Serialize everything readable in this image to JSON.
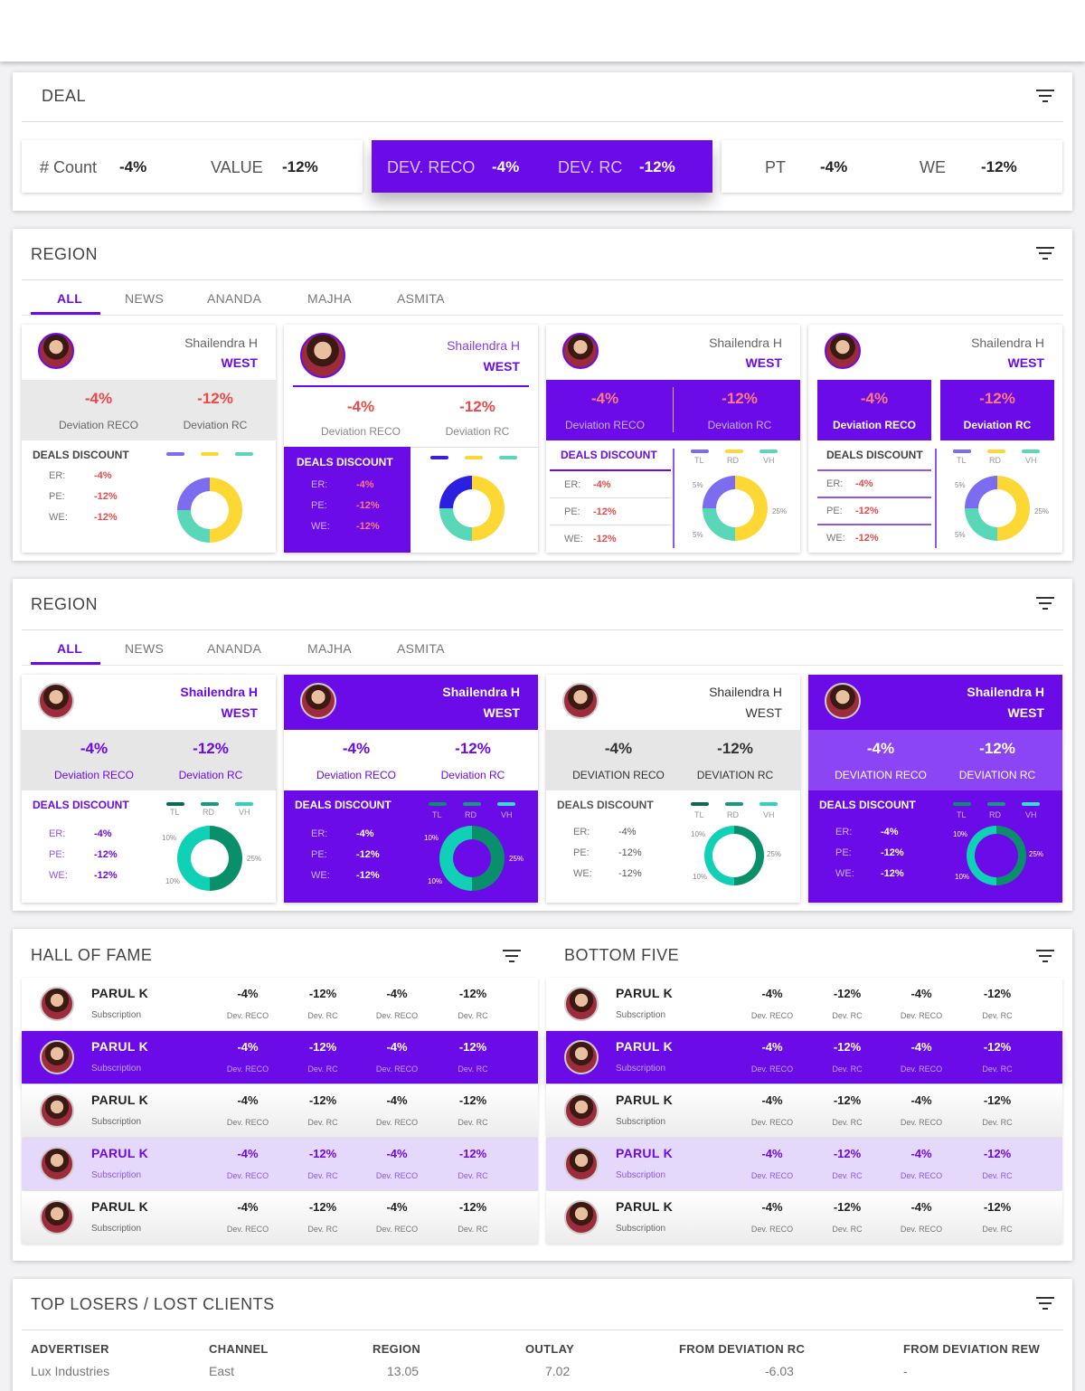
{
  "deal": {
    "title": "DEAL",
    "stats": [
      {
        "l1": "# Count",
        "v1": "-4%",
        "l2": "VALUE",
        "v2": "-12%"
      },
      {
        "l1": "DEV. RECO",
        "v1": "-4%",
        "l2": "DEV. RC",
        "v2": "-12%"
      },
      {
        "l1": "PT",
        "v1": "-4%",
        "l2": "WE",
        "v2": "-12%"
      }
    ]
  },
  "region1": {
    "title": "REGION",
    "tabs": [
      "ALL",
      "NEWS",
      "ANANDA",
      "MAJHA",
      "ASMITA"
    ],
    "cards": [
      {
        "name": "Shailendra H",
        "region": "WEST",
        "v1": "-4%",
        "v2": "-12%",
        "l1": "Deviation RECO",
        "l2": "Deviation RC",
        "dd": "DEALS DISCOUNT",
        "rows": [
          {
            "k": "ER:",
            "v": "-4%"
          },
          {
            "k": "PE:",
            "v": "-12%"
          },
          {
            "k": "WE:",
            "v": "-12%"
          }
        ]
      },
      {
        "name": "Shailendra H",
        "region": "WEST",
        "v1": "-4%",
        "v2": "-12%",
        "l1": "Deviation RECO",
        "l2": "Deviation RC",
        "dd": "DEALS DISCOUNT",
        "rows": [
          {
            "k": "ER:",
            "v": "-4%"
          },
          {
            "k": "PE:",
            "v": "-12%"
          },
          {
            "k": "WE:",
            "v": "-12%"
          }
        ]
      },
      {
        "name": "Shailendra H",
        "region": "WEST",
        "v1": "-4%",
        "v2": "-12%",
        "l1": "Deviation RECO",
        "l2": "Deviation RC",
        "dd": "DEALS DISCOUNT",
        "rows": [
          {
            "k": "ER:",
            "v": "-4%"
          },
          {
            "k": "PE:",
            "v": "-12%"
          },
          {
            "k": "WE:",
            "v": "-12%"
          }
        ],
        "legend": [
          "TL",
          "RD",
          "VH"
        ],
        "pcts": [
          "5%",
          "25%",
          "5%"
        ]
      },
      {
        "name": "Shailendra H",
        "region": "WEST",
        "v1": "-4%",
        "v2": "-12%",
        "l1": "Deviation RECO",
        "l2": "Deviation RC",
        "dd": "DEALS DISCOUNT",
        "rows": [
          {
            "k": "ER:",
            "v": "-4%"
          },
          {
            "k": "PE:",
            "v": "-12%"
          },
          {
            "k": "WE:",
            "v": "-12%"
          }
        ],
        "legend": [
          "TL",
          "RD",
          "VH"
        ],
        "pcts": [
          "5%",
          "25%",
          "5%"
        ]
      }
    ]
  },
  "region2": {
    "title": "REGION",
    "tabs": [
      "ALL",
      "NEWS",
      "ANANDA",
      "MAJHA",
      "ASMITA"
    ],
    "cards": [
      {
        "name": "Shailendra H",
        "region": "WEST",
        "v1": "-4%",
        "v2": "-12%",
        "l1": "Deviation RECO",
        "l2": "Deviation RC",
        "dd": "DEALS DISCOUNT",
        "rows": [
          {
            "k": "ER:",
            "v": "-4%"
          },
          {
            "k": "PE:",
            "v": "-12%"
          },
          {
            "k": "WE:",
            "v": "-12%"
          }
        ],
        "legend": [
          "TL",
          "RD",
          "VH"
        ],
        "pcts": [
          "10%",
          "25%",
          "10%"
        ]
      },
      {
        "name": "Shailendra H",
        "region": "WEST",
        "v1": "-4%",
        "v2": "-12%",
        "l1": "Deviation RECO",
        "l2": "Deviation RC",
        "dd": "DEALS DISCOUNT",
        "rows": [
          {
            "k": "ER:",
            "v": "-4%"
          },
          {
            "k": "PE:",
            "v": "-12%"
          },
          {
            "k": "WE:",
            "v": "-12%"
          }
        ],
        "legend": [
          "TL",
          "RD",
          "VH"
        ],
        "pcts": [
          "10%",
          "25%",
          "10%"
        ]
      },
      {
        "name": "Shailendra H",
        "region": "WEST",
        "v1": "-4%",
        "v2": "-12%",
        "l1": "DEVIATION RECO",
        "l2": "DEVIATION RC",
        "dd": "DEALS DISCOUNT",
        "rows": [
          {
            "k": "ER:",
            "v": "-4%"
          },
          {
            "k": "PE:",
            "v": "-12%"
          },
          {
            "k": "WE:",
            "v": "-12%"
          }
        ],
        "legend": [
          "TL",
          "RD",
          "VH"
        ],
        "pcts": [
          "10%",
          "25%",
          "10%"
        ]
      },
      {
        "name": "Shailendra H",
        "region": "WEST",
        "v1": "-4%",
        "v2": "-12%",
        "l1": "DEVIATION RECO",
        "l2": "DEVIATION RC",
        "dd": "DEALS DISCOUNT",
        "rows": [
          {
            "k": "ER:",
            "v": "-4%"
          },
          {
            "k": "PE:",
            "v": "-12%"
          },
          {
            "k": "WE:",
            "v": "-12%"
          }
        ],
        "legend": [
          "TL",
          "RD",
          "VH"
        ],
        "pcts": [
          "10%",
          "25%",
          "10%"
        ]
      }
    ]
  },
  "hall_of_fame": {
    "title": "HALL OF FAME",
    "rows": [
      {
        "name": "PARUL K",
        "sub": "Subscription",
        "vals": [
          "-4%",
          "-12%",
          "-4%",
          "-12%"
        ],
        "labels": [
          "Dev. RECO",
          "Dev. RC",
          "Dev. RECO",
          "Dev. RC"
        ]
      },
      {
        "name": "PARUL K",
        "sub": "Subscription",
        "vals": [
          "-4%",
          "-12%",
          "-4%",
          "-12%"
        ],
        "labels": [
          "Dev. RECO",
          "Dev. RC",
          "Dev. RECO",
          "Dev. RC"
        ]
      },
      {
        "name": "PARUL K",
        "sub": "Subscription",
        "vals": [
          "-4%",
          "-12%",
          "-4%",
          "-12%"
        ],
        "labels": [
          "Dev. RECO",
          "Dev. RC",
          "Dev. RECO",
          "Dev. RC"
        ]
      },
      {
        "name": "PARUL K",
        "sub": "Subscription",
        "vals": [
          "-4%",
          "-12%",
          "-4%",
          "-12%"
        ],
        "labels": [
          "Dev. RECO",
          "Dev. RC",
          "Dev. RECO",
          "Dev. RC"
        ]
      },
      {
        "name": "PARUL K",
        "sub": "Subscription",
        "vals": [
          "-4%",
          "-12%",
          "-4%",
          "-12%"
        ],
        "labels": [
          "Dev. RECO",
          "Dev. RC",
          "Dev. RECO",
          "Dev. RC"
        ]
      }
    ]
  },
  "bottom_five": {
    "title": "BOTTOM FIVE",
    "rows": [
      {
        "name": "PARUL K",
        "sub": "Subscription",
        "vals": [
          "-4%",
          "-12%",
          "-4%",
          "-12%"
        ],
        "labels": [
          "Dev. RECO",
          "Dev. RC",
          "Dev. RECO",
          "Dev. RC"
        ]
      },
      {
        "name": "PARUL K",
        "sub": "Subscription",
        "vals": [
          "-4%",
          "-12%",
          "-4%",
          "-12%"
        ],
        "labels": [
          "Dev. RECO",
          "Dev. RC",
          "Dev. RECO",
          "Dev. RC"
        ]
      },
      {
        "name": "PARUL K",
        "sub": "Subscription",
        "vals": [
          "-4%",
          "-12%",
          "-4%",
          "-12%"
        ],
        "labels": [
          "Dev. RECO",
          "Dev. RC",
          "Dev. RECO",
          "Dev. RC"
        ]
      },
      {
        "name": "PARUL K",
        "sub": "Subscription",
        "vals": [
          "-4%",
          "-12%",
          "-4%",
          "-12%"
        ],
        "labels": [
          "Dev. RECO",
          "Dev. RC",
          "Dev. RECO",
          "Dev. RC"
        ]
      },
      {
        "name": "PARUL K",
        "sub": "Subscription",
        "vals": [
          "-4%",
          "-12%",
          "-4%",
          "-12%"
        ],
        "labels": [
          "Dev. RECO",
          "Dev. RC",
          "Dev. RECO",
          "Dev. RC"
        ]
      }
    ]
  },
  "losers": {
    "title": "TOP LOSERS / LOST CLIENTS",
    "headers": [
      "ADVERTISER",
      "CHANNEL",
      "REGION",
      "OUTLAY",
      "FROM DEVIATION RC",
      "FROM DEVIATION REW"
    ],
    "row": [
      "Lux Industries",
      "East",
      "13.05",
      "7.02",
      "-6.03",
      "-"
    ]
  },
  "colors": {
    "accent": "#6a0be8",
    "yellow": "#fdd835",
    "teal": "#5ad6b8",
    "periwinkle": "#7b6cf0",
    "green": "#0a8f6b",
    "red": "#e84a4a",
    "lilac": "#e5d9fb"
  },
  "icons": [
    "filter-icon",
    "avatar"
  ]
}
